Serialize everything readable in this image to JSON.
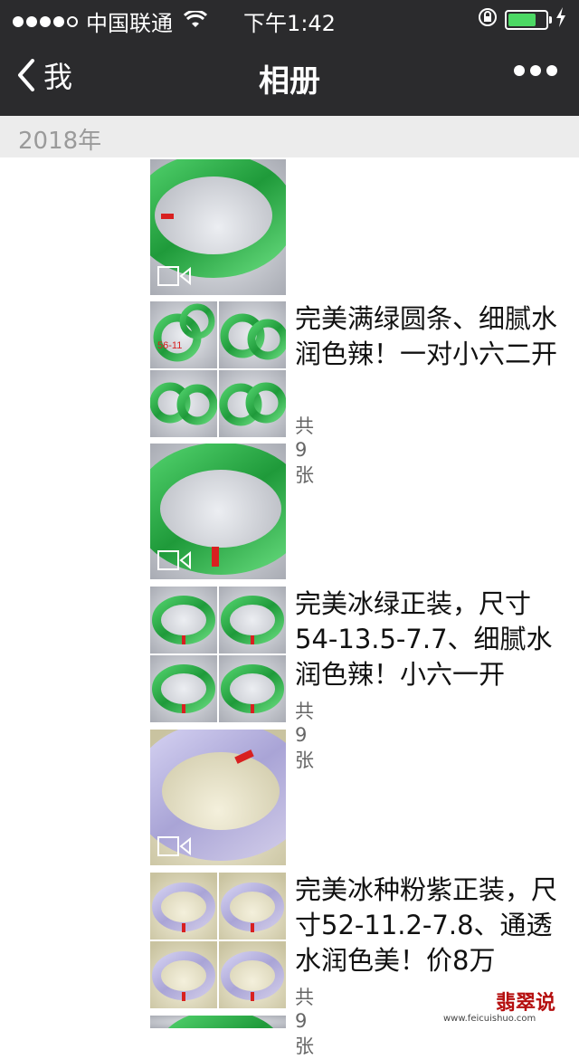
{
  "status_bar": {
    "carrier": "中国联通",
    "time": "下午1:42",
    "battery_level": 0.75
  },
  "nav": {
    "back_label": "我",
    "title": "相册"
  },
  "year_header": "2018年",
  "posts": [
    {
      "type": "video"
    },
    {
      "type": "album",
      "caption": [
        "完美满绿圆条、细腻水",
        "润色辣！一对小六二开"
      ],
      "photo_count": "共9张",
      "grid_labels": [
        "56-11"
      ]
    },
    {
      "type": "video"
    },
    {
      "type": "album",
      "caption": [
        "完美冰绿正装，尺寸",
        "54-13.5-7.7、细腻水",
        "润色辣！小六一开"
      ],
      "photo_count": "共9张"
    },
    {
      "type": "video"
    },
    {
      "type": "album",
      "caption": [
        "完美冰种粉紫正装，尺",
        "寸52-11.2-7.8、通透",
        "水润色美！价8万"
      ],
      "photo_count": "共9张"
    }
  ],
  "watermark": {
    "title": "翡翠说",
    "url": "www.feicuishuo.com"
  },
  "colors": {
    "nav_bg": "#2b2b2d",
    "year_bg": "#ececec",
    "jade_green": "#2fb34a",
    "lavender": "#b8b3dc",
    "battery": "#4cd964"
  }
}
